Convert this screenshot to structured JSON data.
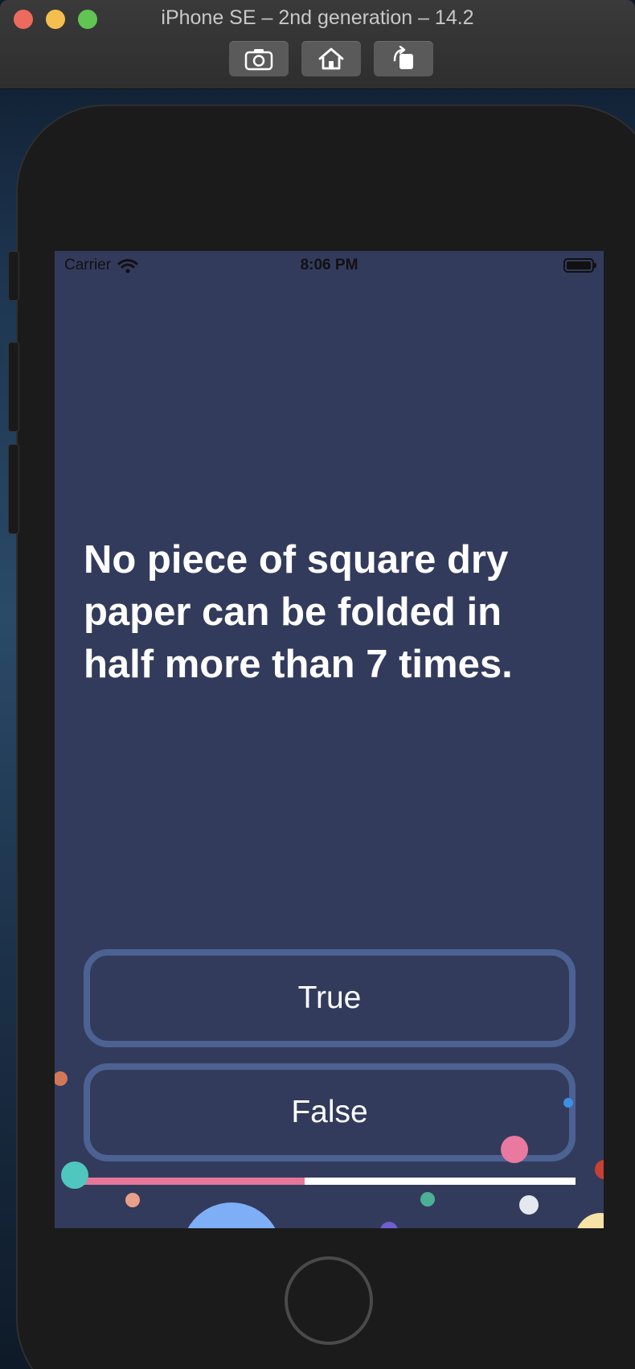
{
  "window": {
    "title": "iPhone SE – 2nd generation – 14.2",
    "toolbar": [
      "screenshot-icon",
      "home-icon",
      "rotate-icon"
    ]
  },
  "status_bar": {
    "carrier": "Carrier",
    "time": "8:06 PM"
  },
  "quiz": {
    "question": "No piece of square dry paper can be folded in half more than 7 times.",
    "answers": {
      "true_label": "True",
      "false_label": "False"
    },
    "progress": 0.45
  },
  "colors": {
    "background": "#333b5c",
    "button_border": "#4c6293",
    "progress_fill": "#e6769a",
    "progress_track": "#ffffff"
  }
}
